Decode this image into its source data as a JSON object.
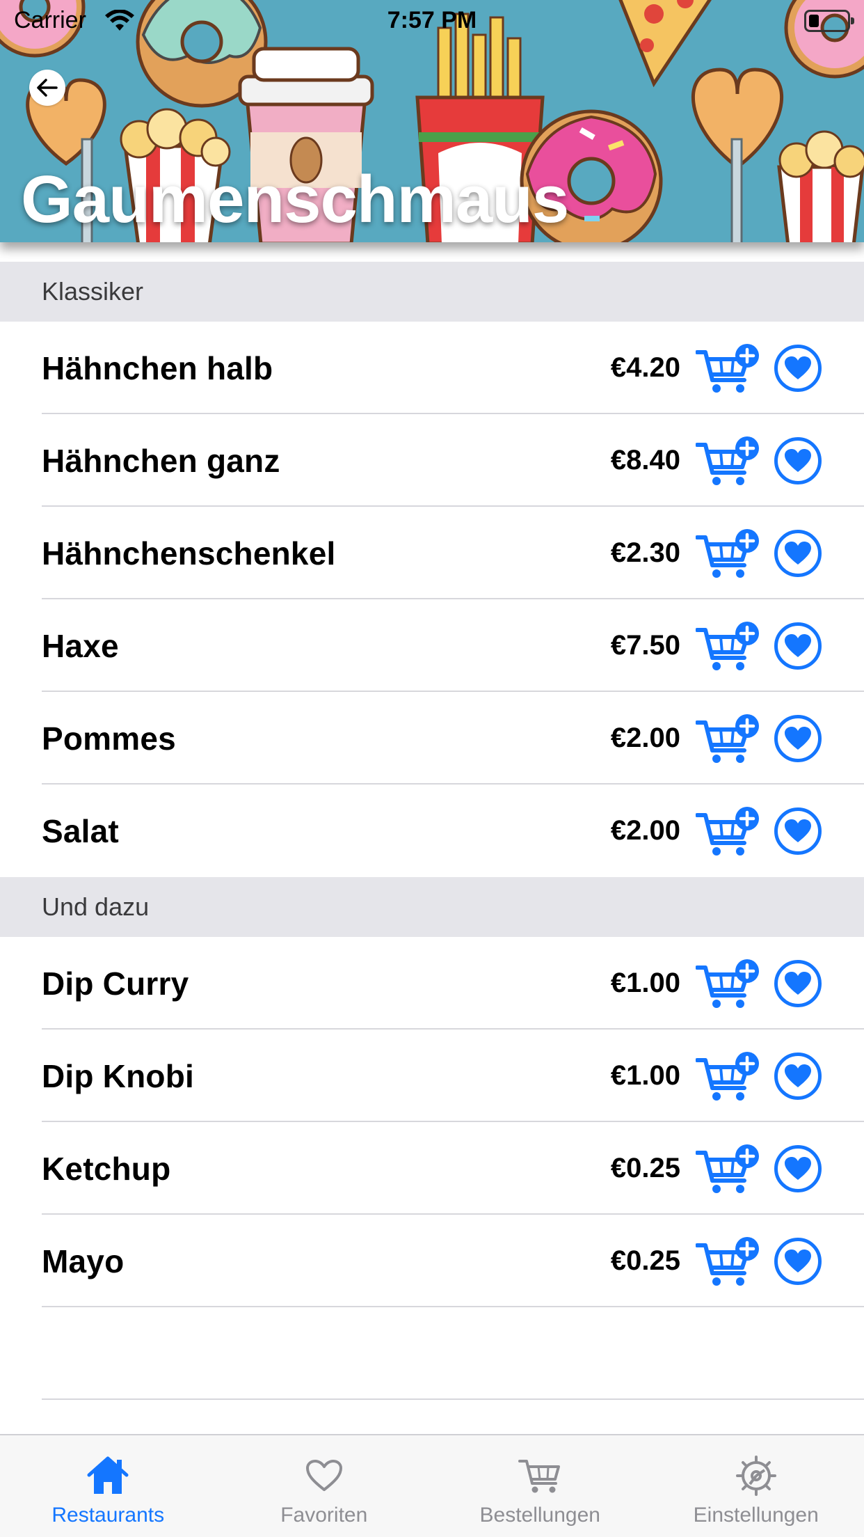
{
  "status_bar": {
    "carrier": "Carrier",
    "time": "7:57 PM"
  },
  "header": {
    "title": "Gaumenschmaus",
    "back_icon": "arrow-left-icon"
  },
  "sections": [
    {
      "title": "Klassiker",
      "items": [
        {
          "name": "Hähnchen halb",
          "price": "€4.20"
        },
        {
          "name": "Hähnchen ganz",
          "price": "€8.40"
        },
        {
          "name": "Hähnchenschenkel",
          "price": "€2.30"
        },
        {
          "name": "Haxe",
          "price": "€7.50"
        },
        {
          "name": "Pommes",
          "price": "€2.00"
        },
        {
          "name": "Salat",
          "price": "€2.00"
        }
      ]
    },
    {
      "title": "Und dazu",
      "items": [
        {
          "name": "Dip Curry",
          "price": "€1.00"
        },
        {
          "name": "Dip Knobi",
          "price": "€1.00"
        },
        {
          "name": "Ketchup",
          "price": "€0.25"
        },
        {
          "name": "Mayo",
          "price": "€0.25"
        }
      ]
    }
  ],
  "item_actions": {
    "add_to_cart_icon": "cart-plus-icon",
    "favorite_icon": "heart-circle-icon"
  },
  "tab_bar": {
    "tabs": [
      {
        "label": "Restaurants",
        "icon": "house-icon",
        "active": true
      },
      {
        "label": "Favoriten",
        "icon": "heart-icon",
        "active": false
      },
      {
        "label": "Bestellungen",
        "icon": "cart-icon",
        "active": false
      },
      {
        "label": "Einstellungen",
        "icon": "gear-icon",
        "active": false
      }
    ]
  },
  "colors": {
    "accent": "#1476ff",
    "section_header_bg": "#e5e5ea",
    "tab_inactive": "#8e8e93",
    "banner_bg": "#58a9c0"
  }
}
